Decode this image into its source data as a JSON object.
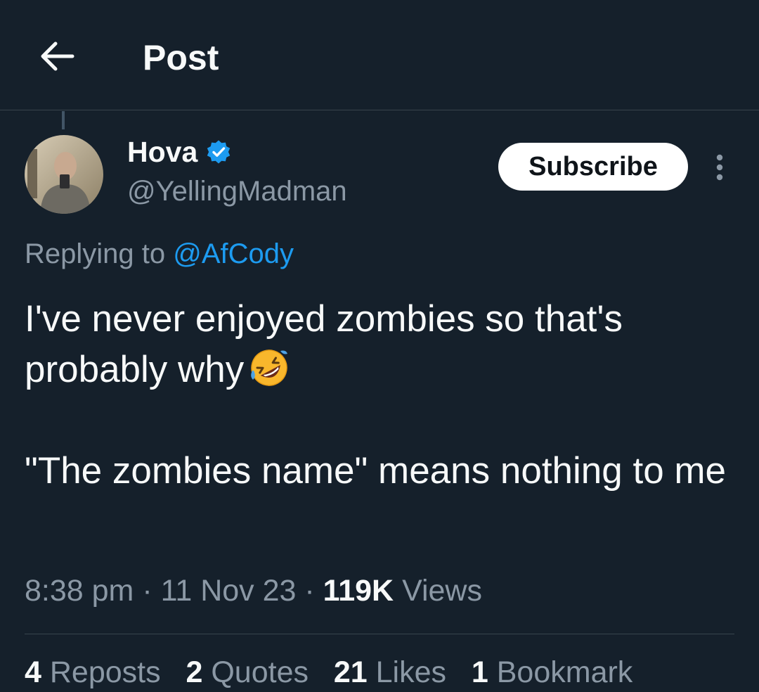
{
  "header": {
    "title": "Post",
    "back_icon": "arrow-left-icon"
  },
  "author": {
    "display_name": "Hova",
    "handle": "@YellingMadman",
    "verified_icon": "verified-badge-icon",
    "verified_color": "#1d9bf0",
    "subscribe_label": "Subscribe",
    "more_icon": "more-vertical-icon"
  },
  "reply": {
    "prefix": "Replying to",
    "handle": "@AfCody"
  },
  "tweet": {
    "paragraph_1": "I've never enjoyed zombies so that's probably why",
    "emoji_icon": "rolling-on-floor-laughing-emoji",
    "paragraph_2": "\"The zombies name\" means nothing to me"
  },
  "meta": {
    "time": "8:38 pm",
    "separator": "·",
    "date": "11 Nov 23",
    "views_count": "119K",
    "views_label": "Views"
  },
  "stats": {
    "reposts_count": "4",
    "reposts_label": "Reposts",
    "quotes_count": "2",
    "quotes_label": "Quotes",
    "likes_count": "21",
    "likes_label": "Likes",
    "bookmarks_count": "1",
    "bookmarks_label": "Bookmark"
  },
  "colors": {
    "background": "#15202b",
    "text_primary": "#f7f9f9",
    "text_secondary": "#8b98a5",
    "link": "#1d9bf0",
    "divider": "#38444d"
  }
}
